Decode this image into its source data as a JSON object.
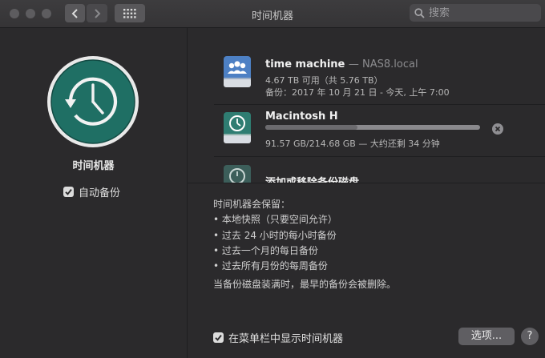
{
  "window": {
    "title": "时间机器"
  },
  "search": {
    "placeholder": "搜索"
  },
  "left": {
    "app_name": "时间机器",
    "auto_backup_label": "自动备份",
    "auto_backup_checked": true
  },
  "disks": [
    {
      "name": "time machine",
      "host": "— NAS8.local",
      "line1": "4.67 TB 可用（共 5.76 TB）",
      "line2": "备份：2017 年 10 月 21 日 - 今天, 上午 7:00"
    },
    {
      "name": "Macintosh H",
      "progress_fraction": 0.43,
      "line1": "91.57 GB/214.68 GB — 大约还剩 34 分钟"
    }
  ],
  "add_remove_label": "添加或移除备份磁盘",
  "keeps": {
    "heading": "时间机器会保留：",
    "items": [
      "• 本地快照（只要空间允许）",
      "• 过去 24 小时的每小时备份",
      "• 过去一个月的每日备份",
      "• 过去所有月份的每周备份"
    ],
    "full_note": "当备份磁盘装满时，最早的备份会被删除。"
  },
  "menubar_option": {
    "label": "在菜单栏中显示时间机器",
    "checked": true
  },
  "buttons": {
    "options": "选项...",
    "help": "?"
  },
  "colors": {
    "accent_teal": "#1f6f64",
    "window_bg": "#2b2a2c"
  }
}
